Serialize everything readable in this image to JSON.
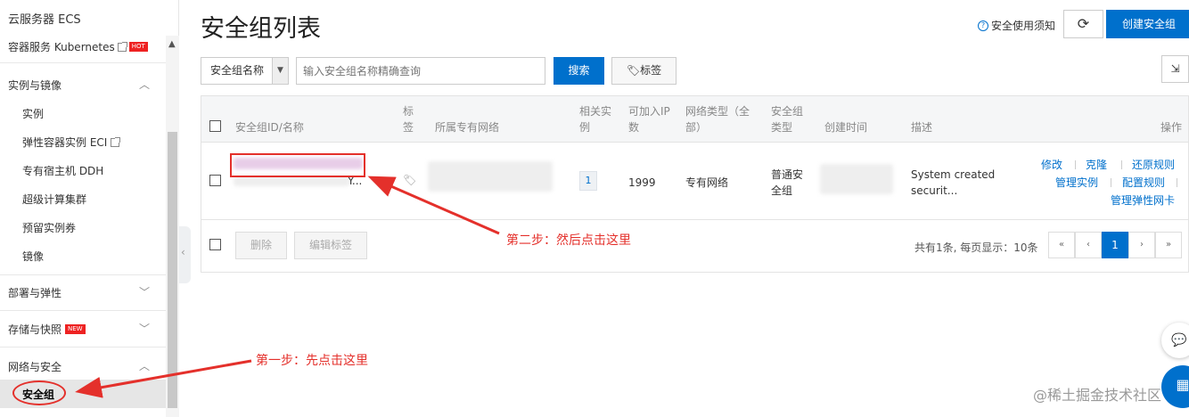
{
  "sidebar": {
    "title": "云服务器 ECS",
    "k8s": {
      "label": "容器服务 Kubernetes",
      "badge": "HOT"
    },
    "groups": [
      {
        "label": "实例与镜像"
      },
      {
        "label": "部署与弹性"
      },
      {
        "label": "存储与快照",
        "badge": "NEW"
      },
      {
        "label": "网络与安全"
      }
    ],
    "items": [
      {
        "label": "实例"
      },
      {
        "label": "弹性容器实例 ECI"
      },
      {
        "label": "专有宿主机 DDH"
      },
      {
        "label": "超级计算集群"
      },
      {
        "label": "预留实例券"
      },
      {
        "label": "镜像"
      }
    ],
    "active_item": "安全组"
  },
  "header": {
    "title": "安全组列表",
    "help": "安全使用须知",
    "create": "创建安全组"
  },
  "filter": {
    "select_value": "安全组名称",
    "placeholder": "输入安全组名称精确查询",
    "search": "搜索",
    "tag": "标签"
  },
  "table": {
    "headers": {
      "id": "安全组ID/名称",
      "tag": "标签",
      "vpc": "所属专有网络",
      "instances": "相关实例",
      "ip": "可加入IP数",
      "net_type": "网络类型（全部）",
      "sg_type": "安全组类型",
      "created": "创建时间",
      "desc": "描述",
      "ops": "操作"
    },
    "row": {
      "name_suffix": "Y...",
      "instances": "1",
      "ip": "1999",
      "net_type": "专有网络",
      "sg_type": "普通安全组",
      "desc": "System created securit...",
      "ops": [
        "修改",
        "克隆",
        "还原规则",
        "管理实例",
        "配置规则",
        "管理弹性网卡"
      ]
    },
    "footer": {
      "delete": "删除",
      "edit_tag": "编辑标签",
      "summary": "共有1条, 每页显示：10条",
      "current_page": "1"
    }
  },
  "annotations": {
    "step1": "第一步：先点击这里",
    "step2": "第二步：然后点击这里",
    "color": "#e4302b"
  },
  "watermark": "@稀土掘金技术社区",
  "colors": {
    "primary": "#0070cc",
    "annotation": "#e4302b"
  }
}
